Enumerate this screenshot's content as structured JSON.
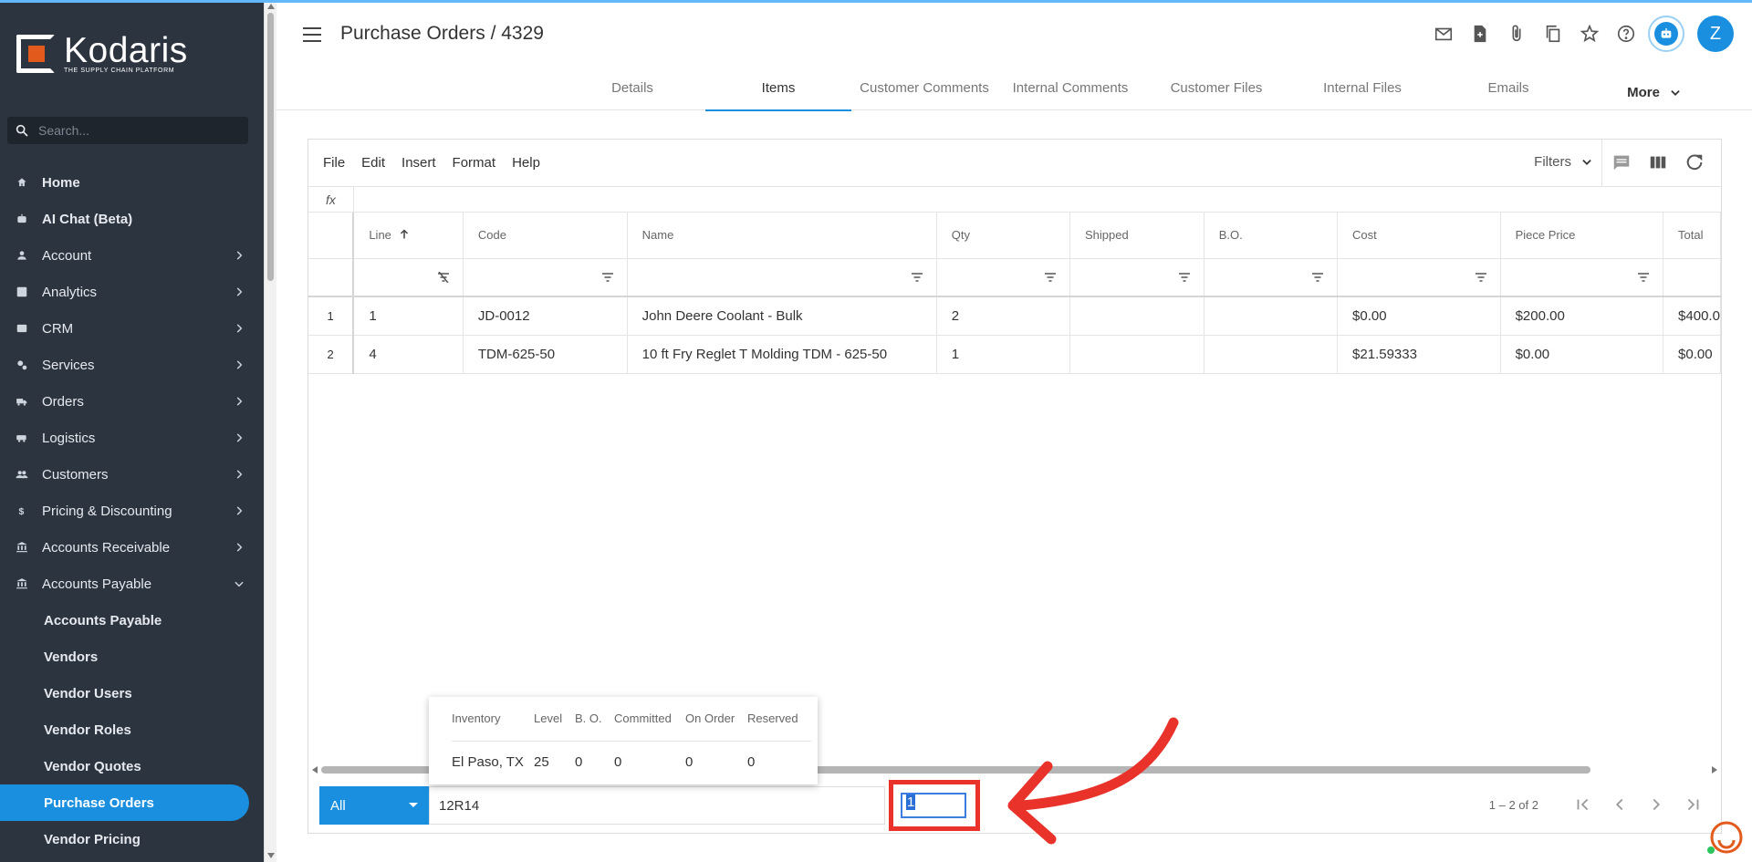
{
  "brand": {
    "name": "Kodaris",
    "tagline": "THE SUPPLY CHAIN PLATFORM"
  },
  "search": {
    "placeholder": "Search..."
  },
  "sidebar": {
    "items": [
      {
        "label": "Home",
        "icon": "home-icon"
      },
      {
        "label": "AI Chat (Beta)",
        "icon": "robot-icon"
      },
      {
        "label": "Account",
        "icon": "person-icon"
      },
      {
        "label": "Analytics",
        "icon": "chart-icon"
      },
      {
        "label": "CRM",
        "icon": "contact-card-icon"
      },
      {
        "label": "Services",
        "icon": "gears-icon"
      },
      {
        "label": "Orders",
        "icon": "truck-icon"
      },
      {
        "label": "Logistics",
        "icon": "van-icon"
      },
      {
        "label": "Customers",
        "icon": "people-icon"
      },
      {
        "label": "Pricing & Discounting",
        "icon": "dollar-icon"
      },
      {
        "label": "Accounts Receivable",
        "icon": "bank-icon"
      },
      {
        "label": "Accounts Payable",
        "icon": "bank-icon"
      }
    ],
    "subitems": [
      {
        "label": "Accounts Payable"
      },
      {
        "label": "Vendors"
      },
      {
        "label": "Vendor Users"
      },
      {
        "label": "Vendor Roles"
      },
      {
        "label": "Vendor Quotes"
      },
      {
        "label": "Purchase Orders",
        "active": true
      },
      {
        "label": "Vendor Pricing"
      }
    ]
  },
  "header": {
    "title": "Purchase Orders / 4329",
    "avatar_initial": "Z",
    "icons": [
      "mail-icon",
      "new-document-icon",
      "attachment-icon",
      "copy-icon",
      "star-icon",
      "help-icon",
      "robot-icon"
    ]
  },
  "tabs": [
    {
      "label": "Details"
    },
    {
      "label": "Items",
      "active": true
    },
    {
      "label": "Customer Comments"
    },
    {
      "label": "Internal Comments"
    },
    {
      "label": "Customer Files"
    },
    {
      "label": "Internal Files"
    },
    {
      "label": "Emails"
    },
    {
      "label": "More"
    }
  ],
  "menubar": {
    "menus": [
      "File",
      "Edit",
      "Insert",
      "Format",
      "Help"
    ],
    "filters_label": "Filters"
  },
  "fx_label": "fx",
  "grid": {
    "columns": [
      "Line",
      "Code",
      "Name",
      "Qty",
      "Shipped",
      "B.O.",
      "Cost",
      "Piece Price",
      "Total"
    ],
    "rows": [
      {
        "num": "1",
        "cells": [
          "1",
          "JD-0012",
          "John Deere Coolant - Bulk",
          "2",
          "",
          "",
          "$0.00",
          "$200.00",
          "$400.0"
        ]
      },
      {
        "num": "2",
        "cells": [
          "4",
          "TDM-625-50",
          "10 ft Fry Reglet T Molding TDM - 625-50",
          "1",
          "",
          "",
          "$21.59333",
          "$0.00",
          "$0.00"
        ]
      }
    ]
  },
  "footer": {
    "scope": "All",
    "code_value": "12R14",
    "qty_value": "1",
    "page_info": "1 – 2 of 2"
  },
  "inventory_popup": {
    "headers": [
      "Inventory",
      "Level",
      "B. O.",
      "Committed",
      "On Order",
      "Reserved"
    ],
    "row": [
      "El Paso, TX",
      "25",
      "0",
      "0",
      "0",
      "0"
    ]
  },
  "colors": {
    "accent": "#1a8fe0",
    "sidebar_bg": "#2c3440",
    "annotation": "#e8322a"
  }
}
